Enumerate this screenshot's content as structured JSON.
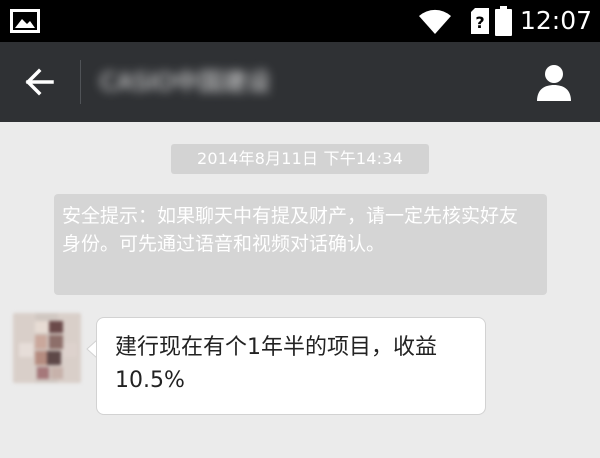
{
  "status_bar": {
    "time": "12:07",
    "icons": [
      "gallery-icon",
      "wifi-icon",
      "sim-unknown-icon",
      "battery-icon"
    ]
  },
  "header": {
    "title": "CASIO中国建设",
    "icons": [
      "back-arrow-icon",
      "person-icon"
    ]
  },
  "messages": {
    "timestamp": "2014年8月11日 下午14:34",
    "system_notice": "安全提示：如果聊天中有提及财产，请一定先核实好友身份。可先通过语音和视频对话确认。",
    "incoming": {
      "text": "建行现在有个1年半的项目，收益10.5%"
    }
  },
  "colors": {
    "status_bar_bg": "#000000",
    "title_bar_bg": "#2f3134",
    "chat_bg": "#ebebeb",
    "timestamp_bg": "#d3d3d3",
    "notice_bg": "#d5d5d5",
    "bubble_bg": "#ffffff"
  }
}
